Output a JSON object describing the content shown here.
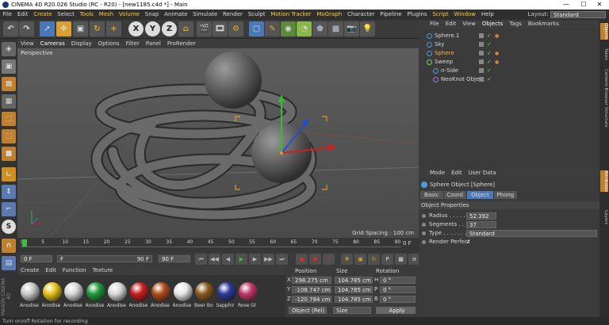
{
  "window": {
    "title": "CINEMA 4D R20.026 Studio (RC - R20) - [new1185.c4d *] - Main",
    "minimize": "—",
    "maximize": "☐",
    "close": "✕"
  },
  "menubar": {
    "items": [
      "File",
      "Edit",
      "Create",
      "Select",
      "Tools",
      "Mesh",
      "Volume",
      "Snap",
      "Animate",
      "Simulate",
      "Render",
      "Sculpt",
      "Motion Tracker",
      "MoGraph",
      "Character",
      "Pipeline",
      "Plugins",
      "Script",
      "Window",
      "Help"
    ],
    "highlighted": [
      "Create",
      "Tools",
      "Mesh",
      "Volume",
      "Motion Tracker",
      "MoGraph",
      "Script",
      "Window"
    ],
    "layout_label": "Layout:",
    "layout_value": "Standard"
  },
  "toolbar": {
    "axis_labels": [
      "X",
      "Y",
      "Z"
    ]
  },
  "viewport": {
    "menu": [
      "View",
      "Cameras",
      "Display",
      "Options",
      "Filter",
      "Panel",
      "ProRender"
    ],
    "label": "Perspective",
    "grid_spacing": "Grid Spacing : 100 cm"
  },
  "timeline": {
    "ticks": [
      "0",
      "5",
      "10",
      "15",
      "20",
      "25",
      "30",
      "35",
      "40",
      "45",
      "50",
      "55",
      "60",
      "65",
      "70",
      "75",
      "80",
      "85",
      "90"
    ],
    "end_field": "0 F"
  },
  "frames": {
    "start": "0 F",
    "current": "F",
    "end_a": "90 F",
    "end_b": "90 F"
  },
  "materials": {
    "menu": [
      "Create",
      "Edit",
      "Function",
      "Texture"
    ],
    "items": [
      {
        "label": "Anodise",
        "color": "#c9c9c9"
      },
      {
        "label": "Anodise",
        "color": "#e6c21a"
      },
      {
        "label": "Anodise",
        "color": "#d8d8d8"
      },
      {
        "label": "Anodise",
        "color": "#1e9a3a"
      },
      {
        "label": "Anodise",
        "color": "#d8d8d8"
      },
      {
        "label": "Anodise",
        "color": "#c81e1e"
      },
      {
        "label": "Anodise",
        "color": "#b04e1c"
      },
      {
        "label": "Anodise",
        "color": "#e8e8e8"
      },
      {
        "label": "Beer Bo",
        "color": "#8a5a20"
      },
      {
        "label": "Sapphir",
        "color": "#2c3a9a"
      },
      {
        "label": "Rose Gl",
        "color": "#c0386a"
      }
    ]
  },
  "coords": {
    "headers": [
      "Position",
      "Size",
      "Rotation"
    ],
    "rows": [
      {
        "axis": "X",
        "pos": "298.275 cm",
        "size": "104.785 cm",
        "rot_axis": "H",
        "rot": "0 °"
      },
      {
        "axis": "Y",
        "pos": "-108.747 cm",
        "size": "104.785 cm",
        "rot_axis": "P",
        "rot": "0 °"
      },
      {
        "axis": "Z",
        "pos": "-120.784 cm",
        "size": "104.785 cm",
        "rot_axis": "B",
        "rot": "0 °"
      }
    ],
    "mode": "Object (Rel)",
    "size_mode": "Size",
    "apply": "Apply"
  },
  "objects": {
    "menu": [
      "File",
      "Edit",
      "View",
      "Objects",
      "Tags",
      "Bookmarks"
    ],
    "items": [
      {
        "name": "Sphere.1",
        "indent": 0,
        "selected": false
      },
      {
        "name": "Sky",
        "indent": 0,
        "selected": false
      },
      {
        "name": "Sphere",
        "indent": 0,
        "selected": true
      },
      {
        "name": "Sweep",
        "indent": 0,
        "selected": false
      },
      {
        "name": "n-Side",
        "indent": 1,
        "selected": false
      },
      {
        "name": "NeoKnot Object",
        "indent": 1,
        "selected": false
      }
    ]
  },
  "attributes": {
    "menu": [
      "Mode",
      "Edit",
      "User Data"
    ],
    "object_title": "Sphere Object [Sphere]",
    "tabs": [
      "Basic",
      "Coord",
      "Object",
      "Phong"
    ],
    "active_tab": "Object",
    "section": "Object Properties",
    "props": [
      {
        "label": "Radius . . . . . . .",
        "value": "52.392 cm"
      },
      {
        "label": "Segments . . . .",
        "value": "37"
      },
      {
        "label": "Type . . . . . . . . .",
        "value": "Standard"
      },
      {
        "label": "Render Perfect",
        "value": "✓"
      }
    ]
  },
  "right_tabs": [
    "Objects",
    "Takes",
    "Content Browser",
    "Structure",
    "Attributes",
    "Layers"
  ],
  "status": "Turn on/off Rotation for recording"
}
